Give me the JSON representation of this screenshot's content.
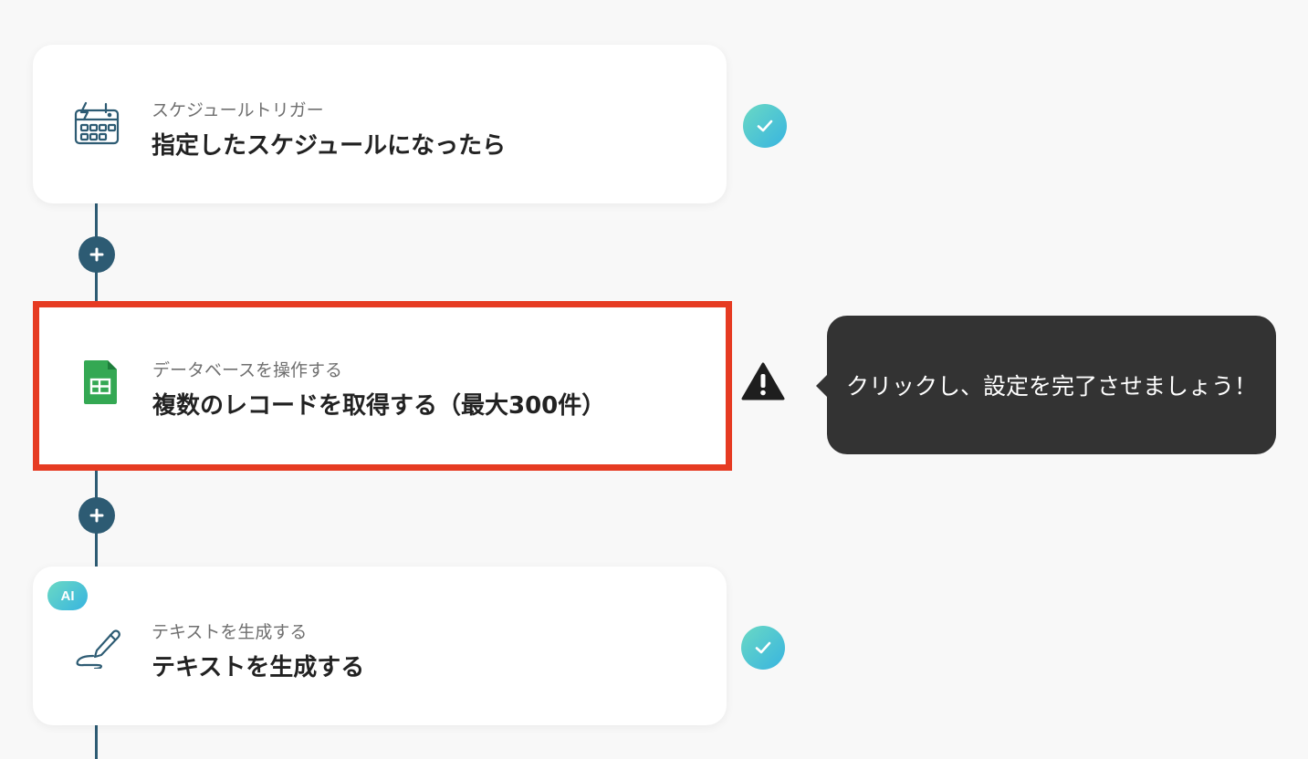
{
  "steps": [
    {
      "category": "スケジュールトリガー",
      "title": "指定したスケジュールになったら",
      "icon": "schedule-calendar-icon",
      "status": "complete"
    },
    {
      "category": "データベースを操作する",
      "title": "複数のレコードを取得する（最大300件）",
      "icon": "google-sheets-icon",
      "status": "warning"
    },
    {
      "category": "テキストを生成する",
      "title": "テキストを生成する",
      "icon": "pen-write-icon",
      "status": "complete",
      "badge": "AI"
    }
  ],
  "tooltip": {
    "text": "クリックし、設定を完了させましょう！"
  },
  "colors": {
    "connector": "#2d5b73",
    "highlight_border": "#e63b22",
    "status_gradient_start": "#6ad9c4",
    "status_gradient_end": "#38b4e0",
    "sheets_green": "#34a853",
    "tooltip_bg": "#333333"
  }
}
